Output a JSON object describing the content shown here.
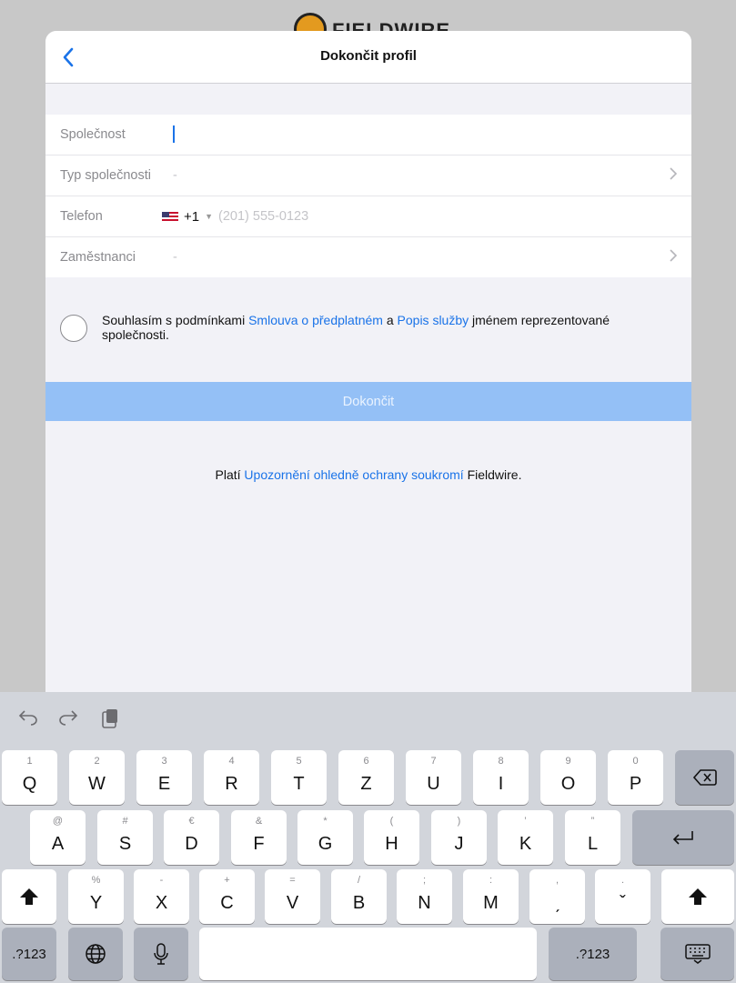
{
  "logo": {
    "text": "FIELDWIRE"
  },
  "navbar": {
    "title": "Dokončit profil",
    "back_icon": "chevron-left-icon"
  },
  "form": {
    "rows": [
      {
        "label": "Společnost",
        "value": ""
      },
      {
        "label": "Typ společnosti",
        "value": "-"
      },
      {
        "label": "Telefon",
        "country_code": "+1",
        "placeholder": "(201) 555-0123"
      },
      {
        "label": "Zaměstnanci",
        "value": "-"
      }
    ]
  },
  "agreement": {
    "text_before": "Souhlasím s podmínkami ",
    "link1": "Smlouva o předplatném",
    "text_mid": " a ",
    "link2": "Popis služby",
    "text_after": " jménem reprezentované společnosti."
  },
  "submit": {
    "label": "Dokončit"
  },
  "privacy": {
    "before": "Platí ",
    "link": "Upozornění ohledně ochrany soukromí",
    "after": " Fieldwire."
  },
  "keyboard": {
    "row1": [
      {
        "main": "Q",
        "alt": "1"
      },
      {
        "main": "W",
        "alt": "2"
      },
      {
        "main": "E",
        "alt": "3"
      },
      {
        "main": "R",
        "alt": "4"
      },
      {
        "main": "T",
        "alt": "5"
      },
      {
        "main": "Z",
        "alt": "6"
      },
      {
        "main": "U",
        "alt": "7"
      },
      {
        "main": "I",
        "alt": "8"
      },
      {
        "main": "O",
        "alt": "9"
      },
      {
        "main": "P",
        "alt": "0"
      }
    ],
    "row2": [
      {
        "main": "A",
        "alt": "@"
      },
      {
        "main": "S",
        "alt": "#"
      },
      {
        "main": "D",
        "alt": "€"
      },
      {
        "main": "F",
        "alt": "&"
      },
      {
        "main": "G",
        "alt": "*"
      },
      {
        "main": "H",
        "alt": "("
      },
      {
        "main": "J",
        "alt": ")"
      },
      {
        "main": "K",
        "alt": "’"
      },
      {
        "main": "L",
        "alt": "”"
      }
    ],
    "row3": [
      {
        "main": "Y",
        "alt": "%"
      },
      {
        "main": "X",
        "alt": "-"
      },
      {
        "main": "C",
        "alt": "+"
      },
      {
        "main": "V",
        "alt": "="
      },
      {
        "main": "B",
        "alt": "/"
      },
      {
        "main": "N",
        "alt": ";"
      },
      {
        "main": "M",
        "alt": ":"
      },
      {
        "main": "ˏ",
        "alt": ","
      },
      {
        "main": "ˇ",
        "alt": "."
      }
    ],
    "numbers_label": ".?123"
  }
}
